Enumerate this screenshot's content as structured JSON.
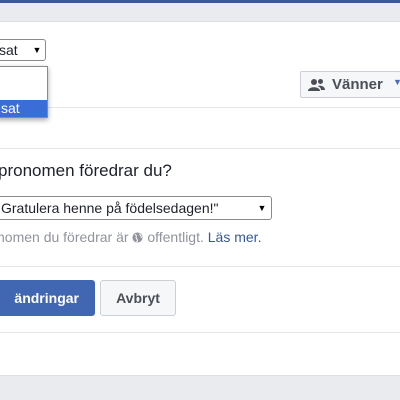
{
  "gender": {
    "selected_label": "sat",
    "options": [
      "",
      "sat"
    ]
  },
  "audience": {
    "label": "Vänner",
    "icon": "friends-icon",
    "caret_icon": "caret-down-icon"
  },
  "pronoun": {
    "question": "pronomen föredrar du?",
    "selected_label": "Gratulera henne på födelsedagen!\"",
    "info_text": "nomen du föredrar är",
    "info_public": "offentligt.",
    "info_link": "Läs mer.",
    "info_icon": "globe-icon"
  },
  "actions": {
    "save_label": "ändringar",
    "cancel_label": "Avbryt"
  },
  "colors": {
    "accent": "#4267b2",
    "header": "#3b5998",
    "link": "#365899",
    "selection": "#3a6ed6"
  }
}
